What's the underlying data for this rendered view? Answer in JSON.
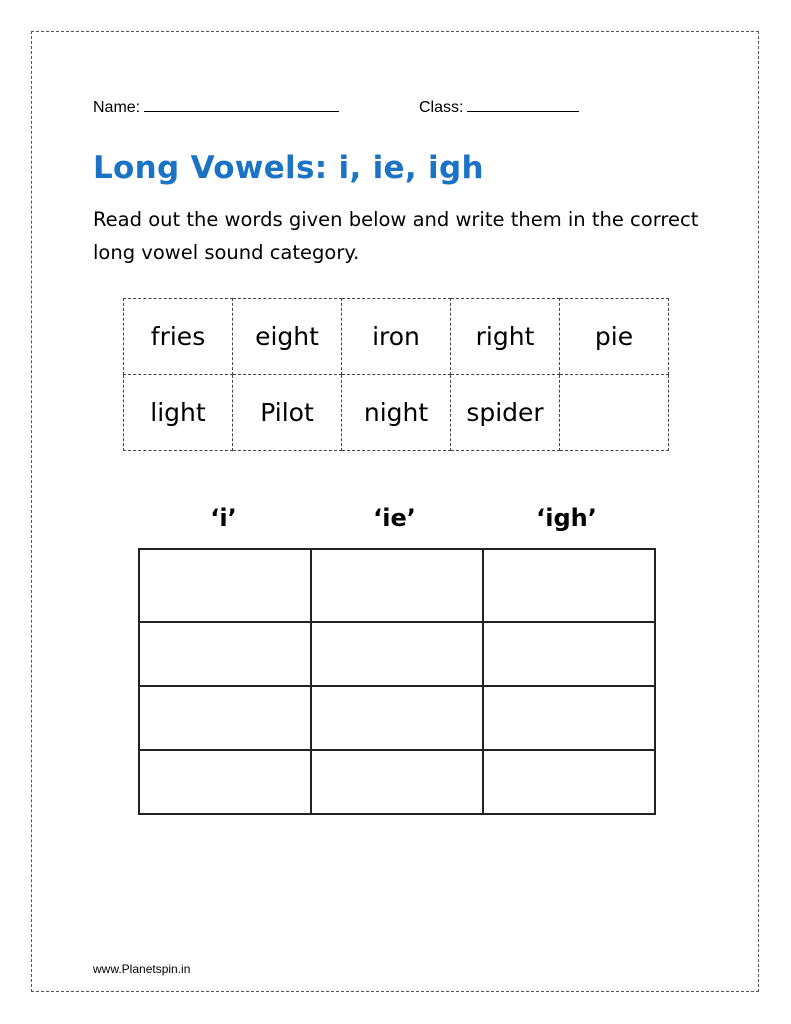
{
  "header": {
    "name_label": "Name:",
    "class_label": "Class:"
  },
  "title": "Long Vowels: i, ie, igh",
  "instructions": "Read out the words given below and write them in the correct long vowel sound category.",
  "word_bank": {
    "rows": [
      [
        "fries",
        "eight",
        "iron",
        "right",
        "pie"
      ],
      [
        "light",
        "Pilot",
        "night",
        "spider",
        ""
      ]
    ]
  },
  "categories": [
    "‘i’",
    "‘ie’",
    "‘igh’"
  ],
  "answer_grid": {
    "rows": 4,
    "columns": 3
  },
  "footer": {
    "website": "www.Planetspin.in"
  },
  "colors": {
    "title": "#1a73c4"
  }
}
